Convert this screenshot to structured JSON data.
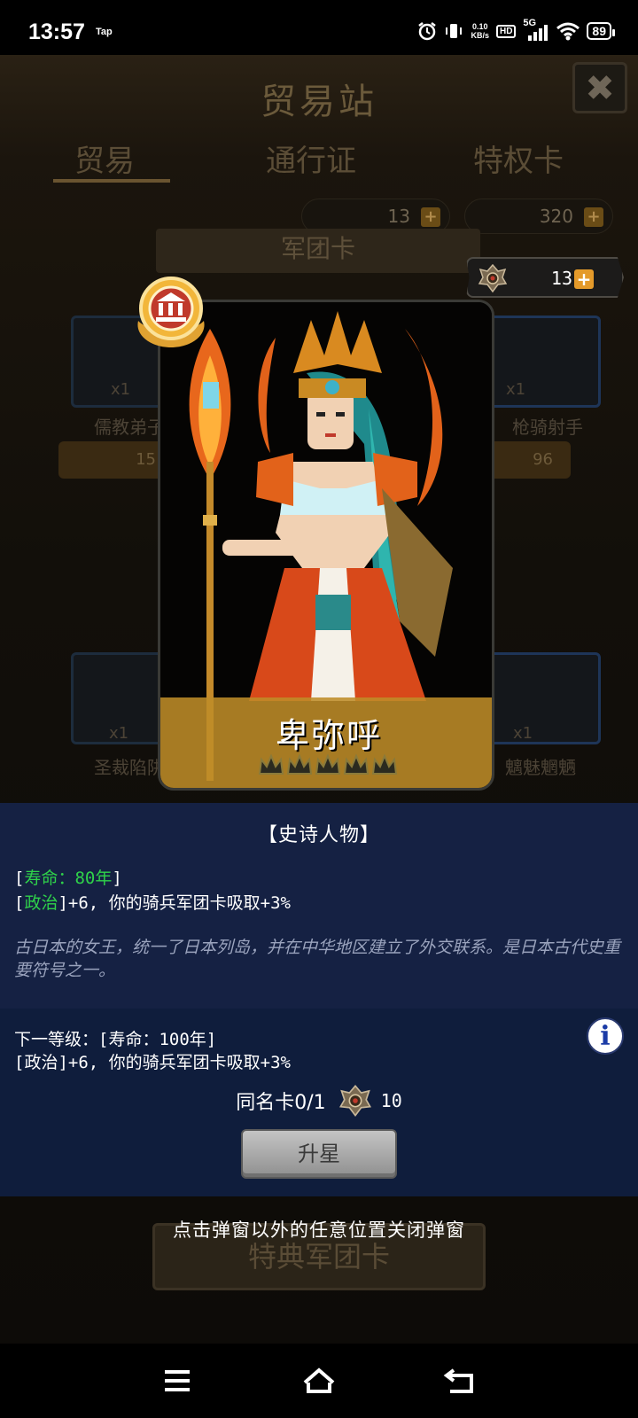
{
  "status_bar": {
    "time": "13:57",
    "app_indicator": "Tap",
    "net_speed_value": "0.10",
    "net_speed_unit": "KB/s",
    "hd_label": "HD",
    "network_label": "5G",
    "battery": "89",
    "icons": [
      "alarm-icon",
      "vibrate-icon",
      "signal-icon",
      "wifi-icon",
      "battery-icon"
    ]
  },
  "background": {
    "title": "贸易站",
    "tabs": [
      "贸易",
      "通行证",
      "特权卡"
    ],
    "currency_emblem_count": "13",
    "currency_gem_count": "320",
    "section_label": "军团卡",
    "cards": [
      {
        "label": "儒教弟子",
        "count": "x1",
        "price": "15"
      },
      {
        "label": "枪骑射手",
        "count": "x1",
        "price": "96"
      },
      {
        "label": "圣裁陷阱",
        "count": "x1"
      },
      {
        "label": "魑魅魍魉",
        "count": "x1"
      }
    ],
    "footer_button": "特典军团卡"
  },
  "popup": {
    "currency_count": "13",
    "character_name": "卑弥呼",
    "star_count": 5,
    "rarity_icon": "bank-icon",
    "info_title": "【史诗人物】",
    "lifespan_label": "[",
    "lifespan_value": "寿命：80年",
    "lifespan_close": "]",
    "politics_open": "[",
    "politics_label": "政治",
    "politics_effect": "]+6, 你的骑兵军团卡吸取+3%",
    "description": "古日本的女王，统一了日本列岛，并在中华地区建立了外交联系。是日本古代史重要符号之一。",
    "next_level_line": "下一等级：[寿命：100年]",
    "next_level_effect": "[政治]+6, 你的骑兵军团卡吸取+3%",
    "info_button": "i",
    "same_card_label": "同名卡0/1",
    "same_card_cost": "10",
    "upgrade_button": "升星",
    "close_hint": "点击弹窗以外的任意位置关闭弹窗"
  },
  "colors": {
    "panel_blue": "#16224a",
    "highlight_green": "#2fd24a",
    "gold": "#e49a2a"
  }
}
